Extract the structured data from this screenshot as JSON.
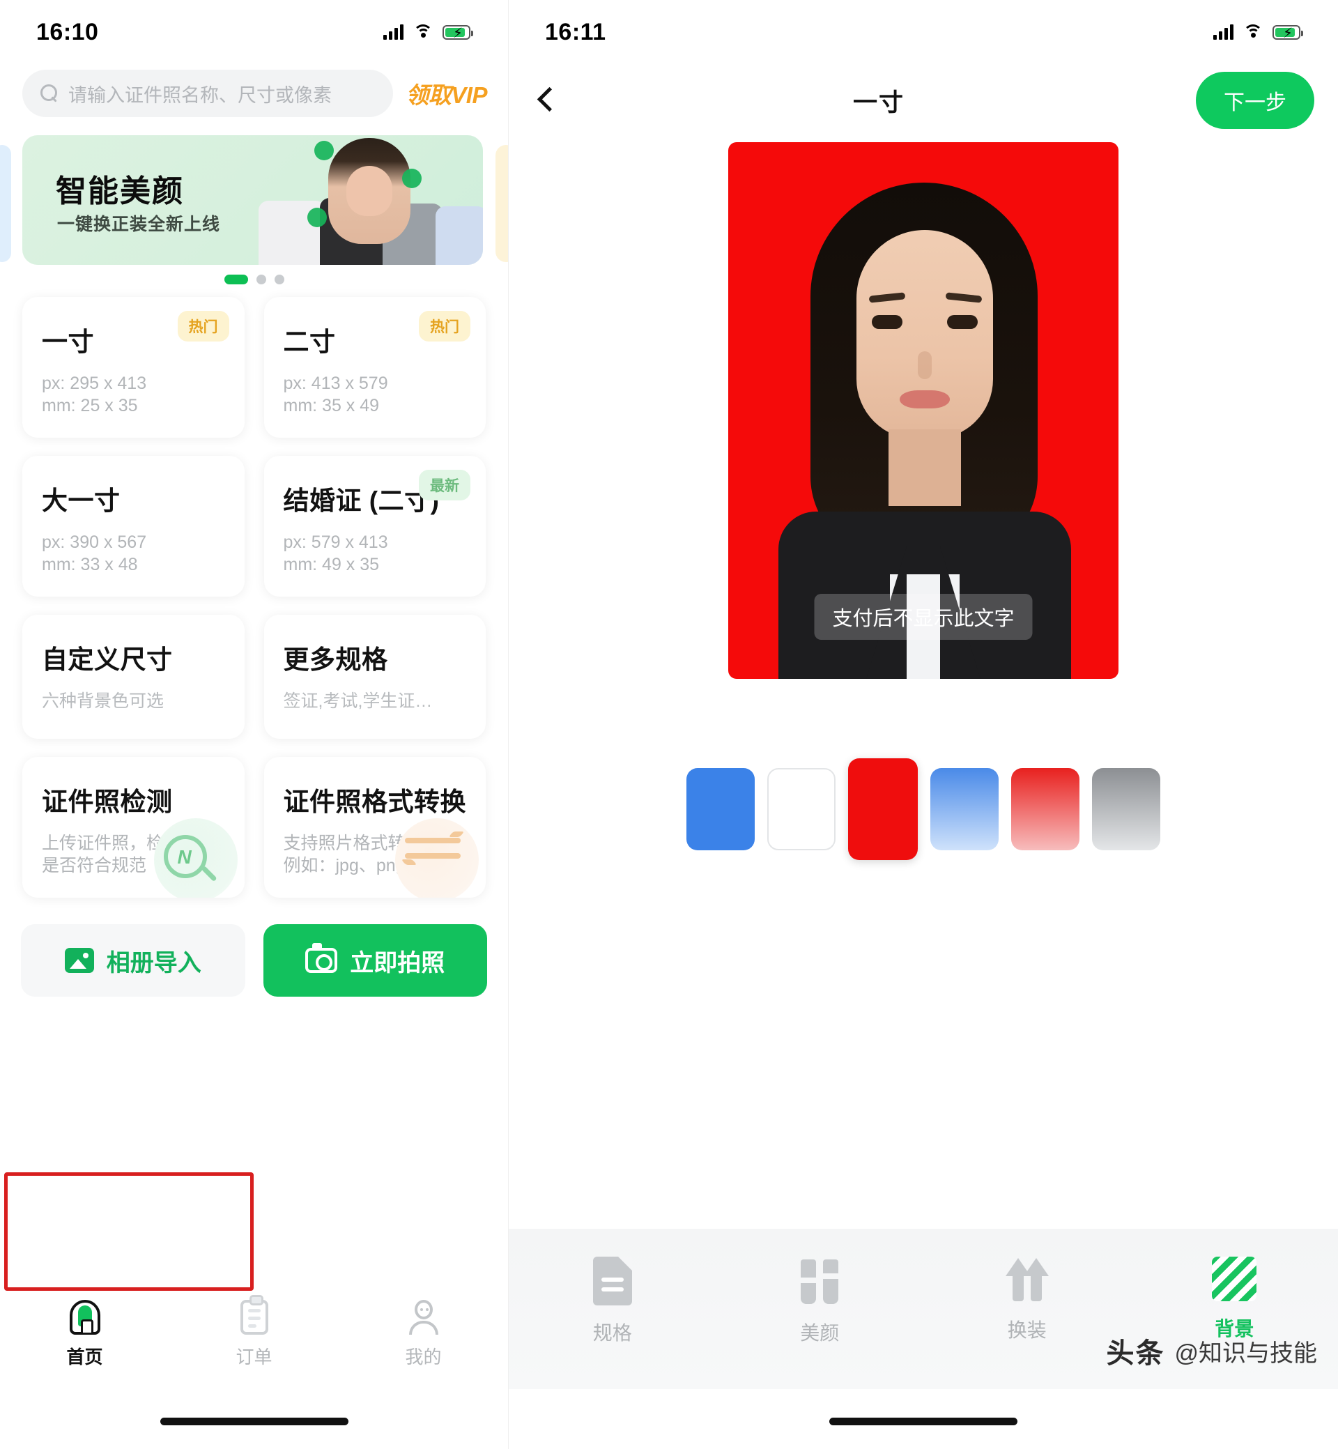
{
  "left": {
    "status": {
      "time": "16:10",
      "signal": "signal-bars-icon",
      "wifi": "wifi-icon",
      "battery": "battery-charging-icon"
    },
    "search": {
      "placeholder": "请输入证件照名称、尺寸或像素",
      "icon": "search-icon",
      "vip_label": "领取VIP"
    },
    "banner": {
      "title": "智能美颜",
      "subtitle": "一键换正装全新上线",
      "dots": 3,
      "active_dot": 1
    },
    "cards": [
      {
        "title": "一寸",
        "badge": "热门",
        "badge_type": "hot",
        "line1": "px: 295 x 413",
        "line2": "mm: 25 x 35"
      },
      {
        "title": "二寸",
        "badge": "热门",
        "badge_type": "hot",
        "line1": "px: 413 x 579",
        "line2": "mm: 35 x 49"
      },
      {
        "title": "大一寸",
        "badge": "",
        "badge_type": "",
        "line1": "px: 390 x 567",
        "line2": "mm: 33 x 48"
      },
      {
        "title": "结婚证 (二寸)",
        "badge": "最新",
        "badge_type": "new",
        "line1": "px: 579 x 413",
        "line2": "mm: 49 x 35"
      },
      {
        "title": "自定义尺寸",
        "badge": "",
        "badge_type": "",
        "sub": "六种背景色可选"
      },
      {
        "title": "更多规格",
        "badge": "",
        "badge_type": "",
        "sub": "签证,考试,学生证…"
      },
      {
        "title": "证件照检测",
        "badge": "",
        "badge_type": "",
        "line1": "上传证件照，检测",
        "line2": "是否符合规范",
        "deco": "magnifier-icon"
      },
      {
        "title": "证件照格式转换",
        "badge": "",
        "badge_type": "",
        "line1": "支持照片格式转换,",
        "line2": "例如：jpg、png…",
        "deco": "swap-arrows-icon"
      }
    ],
    "actions": {
      "album_label": "相册导入",
      "album_icon": "image-icon",
      "camera_label": "立即拍照",
      "camera_icon": "camera-icon"
    },
    "tabs": [
      {
        "label": "首页",
        "icon": "home-icon",
        "active": true
      },
      {
        "label": "订单",
        "icon": "clipboard-icon",
        "active": false
      },
      {
        "label": "我的",
        "icon": "person-icon",
        "active": false
      }
    ]
  },
  "right": {
    "status": {
      "time": "16:11",
      "signal": "signal-bars-icon",
      "wifi": "wifi-icon",
      "battery": "battery-charging-icon"
    },
    "nav": {
      "back_icon": "chevron-left-icon",
      "title": "一寸",
      "next_label": "下一步"
    },
    "photo": {
      "watermark": "支付后不显示此文字",
      "background_color": "#f50a0a"
    },
    "swatches": [
      {
        "name": "blue",
        "color": "#3b82e8",
        "selected": false
      },
      {
        "name": "white",
        "color": "#ffffff",
        "selected": false
      },
      {
        "name": "red",
        "color": "#ef0d0d",
        "selected": true
      },
      {
        "name": "blue-gradient",
        "color": "#4a8ae8",
        "selected": false
      },
      {
        "name": "red-gradient",
        "color": "#e8211f",
        "selected": false
      },
      {
        "name": "gray-gradient",
        "color": "#8c8f93",
        "selected": false
      }
    ],
    "tools": [
      {
        "label": "规格",
        "icon": "document-icon",
        "active": false
      },
      {
        "label": "美颜",
        "icon": "brush-icon",
        "active": false
      },
      {
        "label": "换装",
        "icon": "clothes-icon",
        "active": false
      },
      {
        "label": "背景",
        "icon": "background-pattern-icon",
        "active": true
      }
    ]
  },
  "watermark": {
    "logo": "头条",
    "account": "@知识与技能"
  },
  "colors": {
    "green": "#12c15d",
    "orange": "#f5a020",
    "red_highlight": "#d81f1f"
  }
}
